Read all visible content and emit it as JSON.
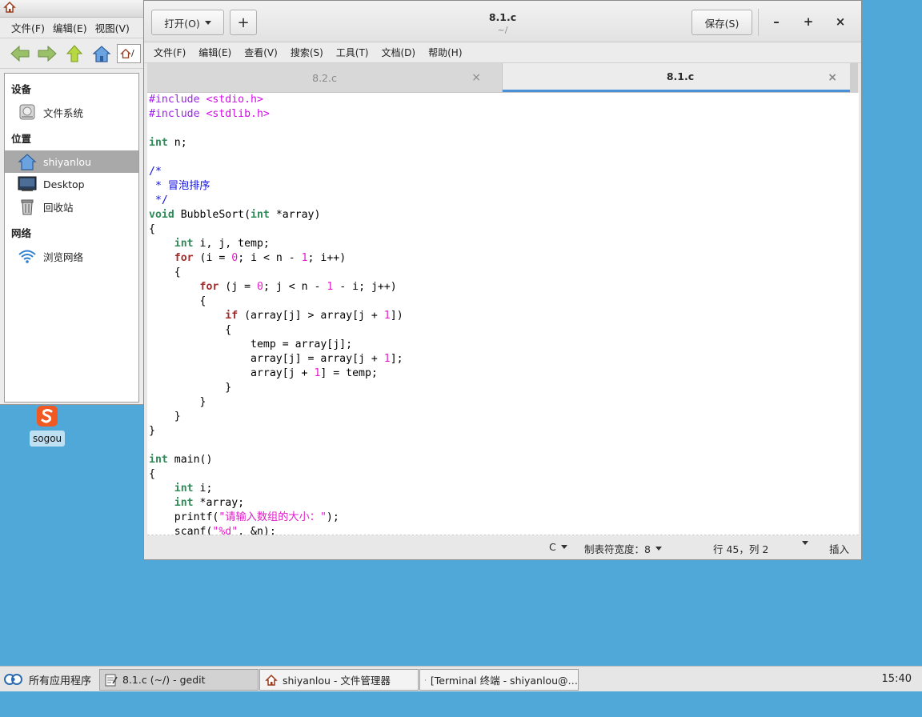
{
  "file_manager": {
    "menu": [
      "文件(F)",
      "编辑(E)",
      "视图(V)"
    ],
    "path_text": "/",
    "sections": [
      {
        "title": "设备",
        "items": [
          {
            "label": "文件系统",
            "icon": "harddisk-icon"
          }
        ]
      },
      {
        "title": "位置",
        "items": [
          {
            "label": "shiyanlou",
            "icon": "home-icon",
            "selected": true
          },
          {
            "label": "Desktop",
            "icon": "desktop-icon"
          },
          {
            "label": "回收站",
            "icon": "trash-icon"
          }
        ]
      },
      {
        "title": "网络",
        "items": [
          {
            "label": "浏览网络",
            "icon": "network-icon"
          }
        ]
      }
    ]
  },
  "desktop": {
    "icons": [
      {
        "label": "sogou",
        "icon": "sogou-icon"
      }
    ]
  },
  "gedit": {
    "open_label": "打开(O)",
    "plus_label": "+",
    "title": "8.1.c",
    "subtitle": "~/",
    "save_label": "保存(S)",
    "minimize": "–",
    "maximize": "+",
    "close": "×",
    "menu": [
      "文件(F)",
      "编辑(E)",
      "查看(V)",
      "搜索(S)",
      "工具(T)",
      "文档(D)",
      "帮助(H)"
    ],
    "tabs": [
      {
        "label": "8.2.c",
        "active": false
      },
      {
        "label": "8.1.c",
        "active": true
      }
    ],
    "tab_close": "×",
    "status": {
      "language": "C",
      "tab_width": "制表符宽度：8",
      "position": "行 45，列 2",
      "mode": "插入"
    }
  },
  "taskbar": {
    "start_label": "所有应用程序",
    "tasks": [
      {
        "label": "8.1.c (~/) - gedit",
        "active": true
      },
      {
        "label": "shiyanlou - 文件管理器",
        "active": false
      },
      {
        "label": "[Terminal 终端 - shiyanlou@…",
        "active": false
      }
    ],
    "clock": "15:40"
  }
}
